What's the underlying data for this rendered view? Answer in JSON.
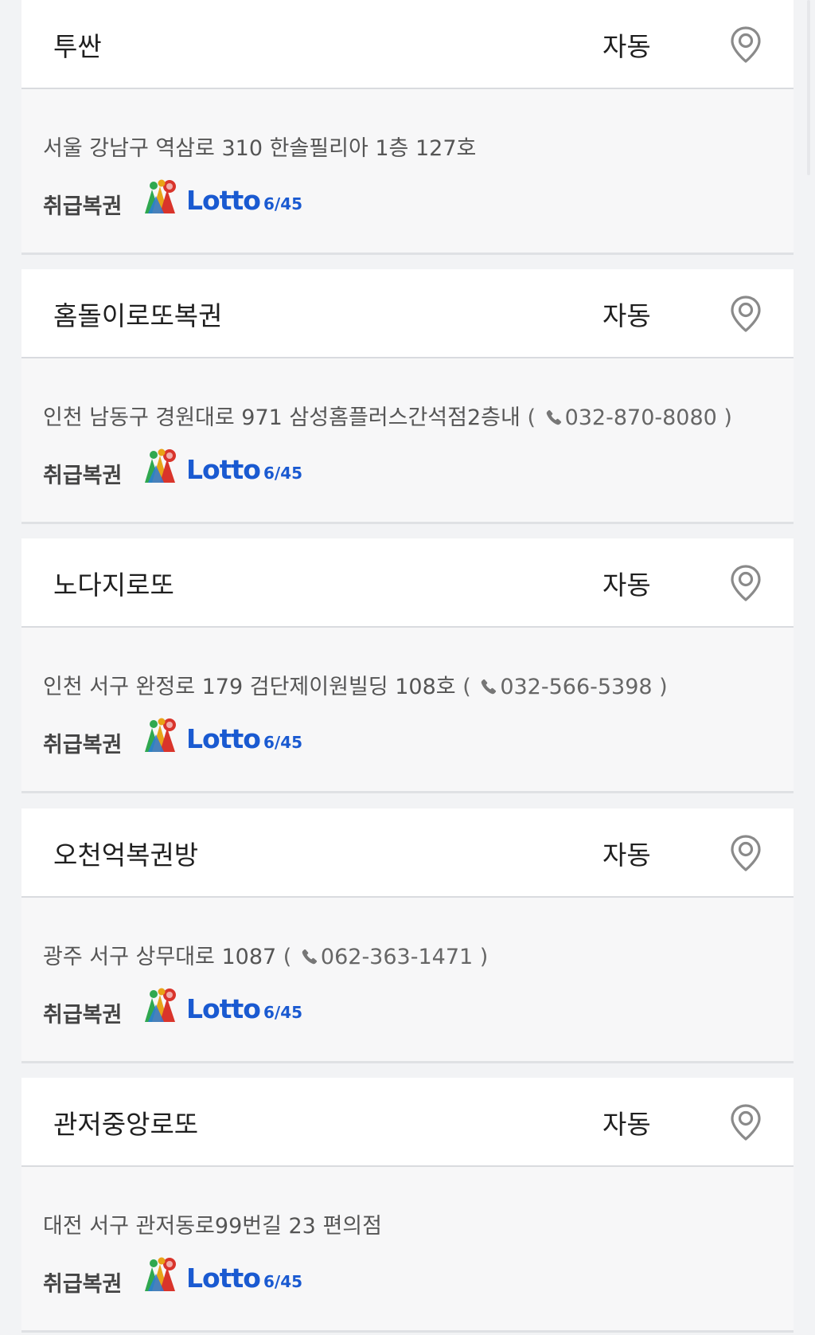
{
  "stores": [
    {
      "name": "투싼",
      "type": "자동",
      "address": "서울 강남구 역삼로 310 한솔필리아 1층 127호",
      "phone": "",
      "ticket_label": "취급복권",
      "logo": {
        "word": "Lotto",
        "number": "6/45"
      }
    },
    {
      "name": "홈돌이로또복권",
      "type": "자동",
      "address": "인천 남동구 경원대로 971 삼성홈플러스간석점2층내",
      "phone": "032-870-8080",
      "ticket_label": "취급복권",
      "logo": {
        "word": "Lotto",
        "number": "6/45"
      }
    },
    {
      "name": "노다지로또",
      "type": "자동",
      "address": "인천 서구 완정로 179 검단제이원빌딩 108호",
      "phone": "032-566-5398",
      "ticket_label": "취급복권",
      "logo": {
        "word": "Lotto",
        "number": "6/45"
      }
    },
    {
      "name": "오천억복권방",
      "type": "자동",
      "address": "광주 서구 상무대로 1087",
      "phone": "062-363-1471",
      "ticket_label": "취급복권",
      "logo": {
        "word": "Lotto",
        "number": "6/45"
      }
    },
    {
      "name": "관저중앙로또",
      "type": "자동",
      "address": "대전 서구 관저동로99번길 23 편의점",
      "phone": "",
      "ticket_label": "취급복권",
      "logo": {
        "word": "Lotto",
        "number": "6/45"
      }
    }
  ],
  "icons": {
    "map": "map-pin-icon",
    "phone": "phone-icon"
  },
  "colors": {
    "lotto_blue": "#1a5ad1",
    "pin_gray": "#8a8a8a"
  }
}
